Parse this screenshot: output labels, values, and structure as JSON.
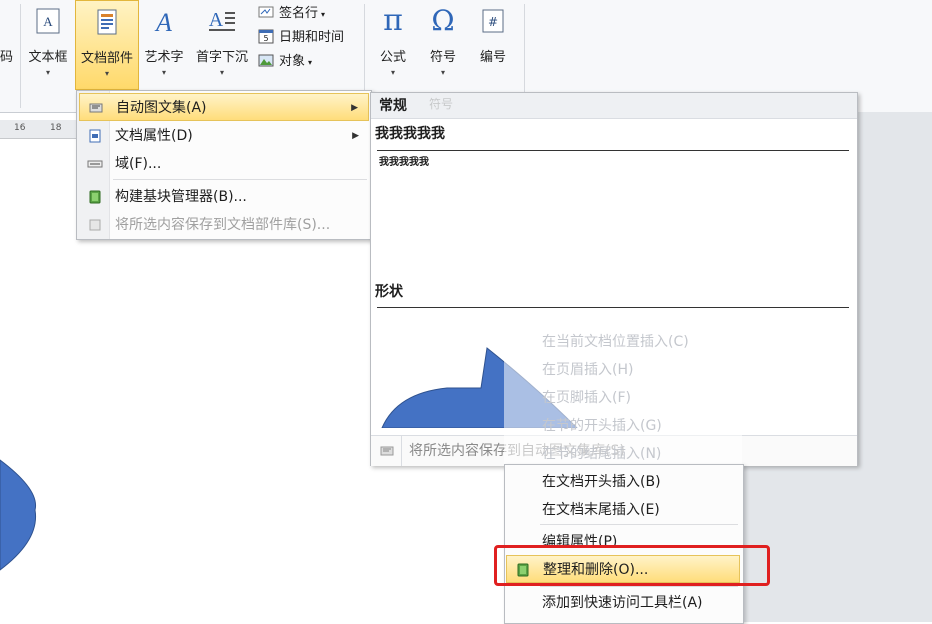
{
  "ribbon": {
    "left_partial_label": "码",
    "textbox": "文本框",
    "quickparts": "文档部件",
    "wordart": "艺术字",
    "dropcap": "首字下沉",
    "signature_line": "签名行",
    "date_time": "日期和时间",
    "object": "对象",
    "equation": "公式",
    "symbol": "符号",
    "number": "编号"
  },
  "ruler": {
    "marks": [
      "16",
      "18"
    ]
  },
  "quickparts_menu": {
    "items": [
      {
        "label": "自动图文集(A)",
        "highlighted": true,
        "submenu": true
      },
      {
        "label": "文档属性(D)",
        "submenu": true
      },
      {
        "label": "域(F)..."
      },
      {
        "label": "构建基块管理器(B)..."
      },
      {
        "label": "将所选内容保存到文档部件库(S)...",
        "disabled": true
      }
    ]
  },
  "autotext_gallery": {
    "section_general": "常规",
    "entry1_title": "我我我我我",
    "entry1_preview": "我我我我我",
    "section_shapes": "形状",
    "save_label": "将所选内容保存到自动图文集库(S)",
    "ghost_symbol_group": "符号"
  },
  "context_menu": {
    "items": [
      {
        "label": "在当前文档位置插入(C)",
        "faded": true
      },
      {
        "label": "在页眉插入(H)",
        "faded": true
      },
      {
        "label": "在页脚插入(F)",
        "faded": true
      },
      {
        "label": "在节的开头插入(G)",
        "faded": true
      },
      {
        "label": "在节的结尾插入(N)",
        "faded": true
      },
      {
        "label": "在文档开头插入(B)"
      },
      {
        "label": "在文档末尾插入(E)"
      },
      {
        "label": "编辑属性(P)"
      },
      {
        "label": "整理和删除(O)...",
        "highlighted": true
      },
      {
        "label": "添加到快速访问工具栏(A)"
      }
    ]
  },
  "colors": {
    "accent_highlight": "#ffdd7a",
    "shape_blue": "#4472c4",
    "annotation_red": "#e02020"
  }
}
